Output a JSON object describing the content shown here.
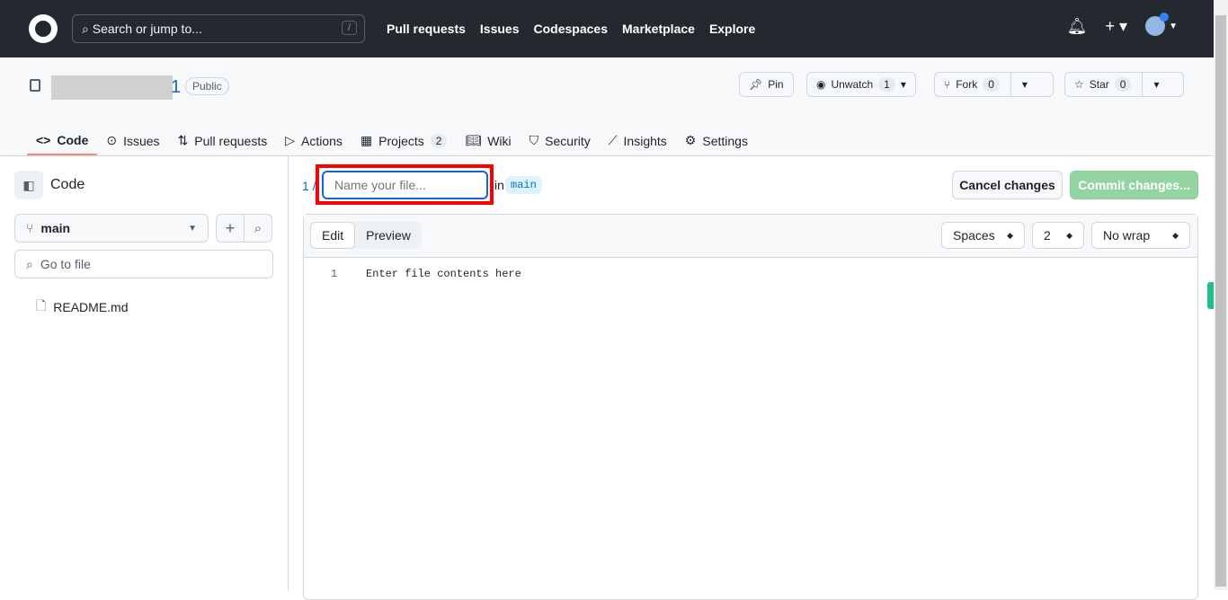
{
  "header": {
    "search_placeholder": "Search or jump to...",
    "search_shortcut": "/",
    "nav": [
      "Pull requests",
      "Issues",
      "Codespaces",
      "Marketplace",
      "Explore"
    ]
  },
  "repo": {
    "name_suffix": "1",
    "visibility": "Public",
    "pin": "Pin",
    "unwatch": "Unwatch",
    "watch_count": "1",
    "fork": "Fork",
    "fork_count": "0",
    "star": "Star",
    "star_count": "0"
  },
  "tabs": [
    {
      "label": "Code"
    },
    {
      "label": "Issues"
    },
    {
      "label": "Pull requests"
    },
    {
      "label": "Actions"
    },
    {
      "label": "Projects",
      "count": "2"
    },
    {
      "label": "Wiki"
    },
    {
      "label": "Security"
    },
    {
      "label": "Insights"
    },
    {
      "label": "Settings"
    }
  ],
  "sidebar": {
    "title": "Code",
    "branch": "main",
    "goto_placeholder": "Go to file",
    "files": [
      "README.md"
    ]
  },
  "editor": {
    "breadcrumb": "1 /",
    "filename_placeholder": "Name your file...",
    "in_label": "in",
    "branch": "main",
    "cancel": "Cancel changes",
    "commit": "Commit changes...",
    "edit_tab": "Edit",
    "preview_tab": "Preview",
    "indent_mode": "Spaces",
    "indent_size": "2",
    "wrap_mode": "No wrap",
    "line_number": "1",
    "placeholder_content": "Enter file contents here"
  }
}
